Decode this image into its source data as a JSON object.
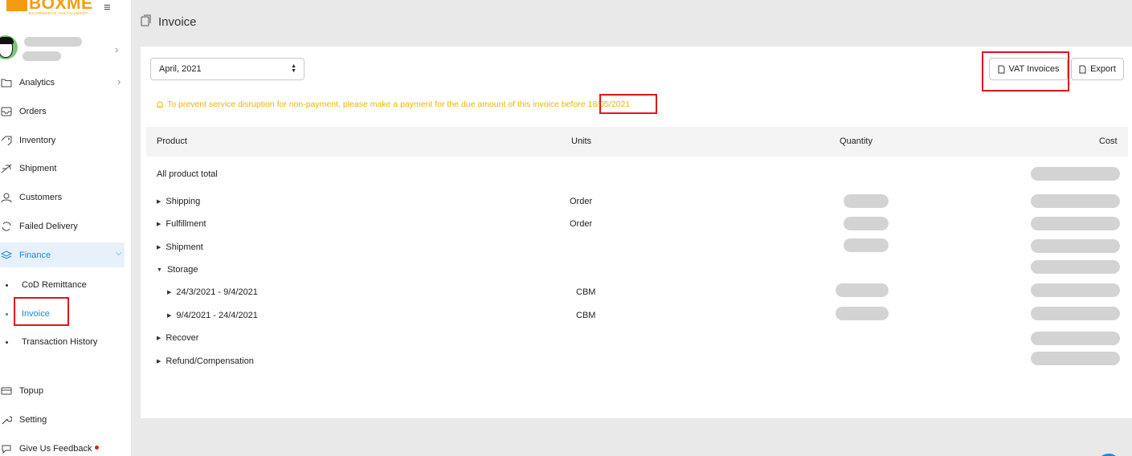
{
  "brand": {
    "name": "BOXME",
    "tagline": "ECOMMERCE FULFILLMENT",
    "accent_color": "#f39c12"
  },
  "sidebar": {
    "items": [
      {
        "label": "Analytics",
        "icon": "chart-icon"
      },
      {
        "label": "Orders",
        "icon": "inbox-icon"
      },
      {
        "label": "Inventory",
        "icon": "tag-icon"
      },
      {
        "label": "Shipment",
        "icon": "plane-icon"
      },
      {
        "label": "Customers",
        "icon": "user-icon"
      },
      {
        "label": "Failed Delivery",
        "icon": "refresh-icon"
      },
      {
        "label": "Finance",
        "icon": "layers-icon"
      }
    ],
    "finance_sub": [
      {
        "label": "CoD Remittance"
      },
      {
        "label": "Invoice"
      },
      {
        "label": "Transaction History"
      }
    ],
    "bottom": [
      {
        "label": "Topup",
        "icon": "card-icon"
      },
      {
        "label": "Setting",
        "icon": "wrench-icon"
      },
      {
        "label": "Give Us Feedback",
        "icon": "chat-icon"
      }
    ]
  },
  "page": {
    "title": "Invoice"
  },
  "toolbar": {
    "month_select": "April, 2021",
    "vat_button": "VAT Invoices",
    "export_button": "Export"
  },
  "warning": {
    "text": "To prevent service disruption for non-payment, please make a payment for the due amount of this invoice before",
    "due_date": "18/05/2021",
    "color": "#f0b400"
  },
  "table": {
    "headers": {
      "product": "Product",
      "units": "Units",
      "quantity": "Quantity",
      "cost": "Cost"
    },
    "rows": [
      {
        "label": "All product total",
        "units": ""
      },
      {
        "label": "Shipping",
        "units": "Order"
      },
      {
        "label": "Fulfillment",
        "units": "Order"
      },
      {
        "label": "Shipment",
        "units": ""
      },
      {
        "label": "Storage",
        "units": ""
      },
      {
        "label": "24/3/2021 - 9/4/2021",
        "units": "CBM"
      },
      {
        "label": "9/4/2021 - 24/4/2021",
        "units": "CBM"
      },
      {
        "label": "Recover",
        "units": ""
      },
      {
        "label": "Refund/Compensation",
        "units": ""
      }
    ]
  }
}
